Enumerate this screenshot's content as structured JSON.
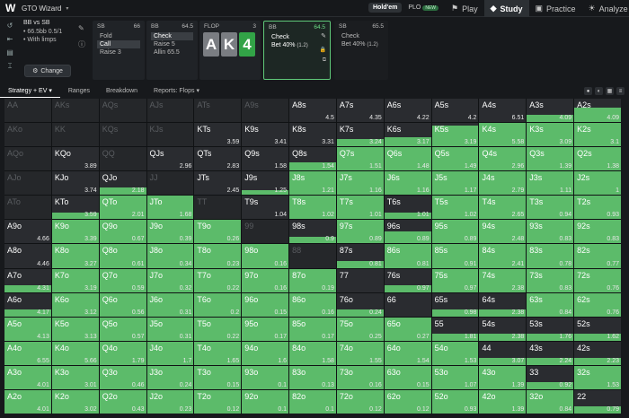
{
  "app": {
    "title": "GTO Wizard"
  },
  "mode": {
    "holdem": "Hold'em",
    "plo": "PLO",
    "plo_badge": "NEW"
  },
  "nav": {
    "play": "Play",
    "study": "Study",
    "practice": "Practice",
    "analyze": "Analyze"
  },
  "scenario": {
    "title": "BB vs SB",
    "stack": "• 66.5bb 0.5/1",
    "limps": "• With limps",
    "change": "Change"
  },
  "nodes": {
    "sb": {
      "pos": "SB",
      "stack": "66",
      "actions": [
        "Fold",
        "Call",
        "Raise 3"
      ]
    },
    "bb": {
      "pos": "BB",
      "stack": "64.5",
      "actions": [
        "Check",
        "Raise 5",
        "Allin 65.5"
      ]
    },
    "flop": {
      "label": "FLOP",
      "pot": "3",
      "cards": [
        "A",
        "K",
        "4"
      ]
    },
    "bb2": {
      "pos": "BB",
      "stack": "64.5",
      "action": "Check",
      "bet": "Bet 40%",
      "bet_size": "(1.2)"
    },
    "sb2": {
      "pos": "SB",
      "stack": "65.5",
      "action": "Check",
      "bet": "Bet 40%",
      "bet_size": "(1.2)"
    }
  },
  "tabs": {
    "strategy": "Strategy + EV",
    "ranges": "Ranges",
    "breakdown": "Breakdown",
    "reports": "Reports: Flops"
  },
  "colors": {
    "bet": "#5cbb6a",
    "check": "#2a2c30",
    "accent": "#6ddf87"
  },
  "matrix": [
    [
      [
        "AA",
        "",
        0,
        1
      ],
      [
        "AKs",
        "",
        0,
        1
      ],
      [
        "AQs",
        "",
        0,
        1
      ],
      [
        "AJs",
        "",
        0,
        1
      ],
      [
        "ATs",
        "",
        0,
        1
      ],
      [
        "A9s",
        "",
        0,
        1
      ],
      [
        "A8s",
        "4.5",
        0,
        0
      ],
      [
        "A7s",
        "4.35",
        0,
        0
      ],
      [
        "A6s",
        "4.22",
        0,
        0
      ],
      [
        "A5s",
        "4.2",
        0,
        0
      ],
      [
        "A4s",
        "6.51",
        0,
        0
      ],
      [
        "A3s",
        "4.09",
        0.3,
        0
      ],
      [
        "A2s",
        "4.09",
        0.6,
        0
      ]
    ],
    [
      [
        "AKo",
        "",
        0,
        1
      ],
      [
        "KK",
        "",
        0,
        1
      ],
      [
        "KQs",
        "",
        0,
        1
      ],
      [
        "KJs",
        "",
        0,
        1
      ],
      [
        "KTs",
        "3.59",
        0,
        0
      ],
      [
        "K9s",
        "3.41",
        0,
        0
      ],
      [
        "K8s",
        "3.31",
        0,
        0
      ],
      [
        "K7s",
        "3.24",
        0.3,
        0
      ],
      [
        "K6s",
        "3.17",
        0.4,
        0
      ],
      [
        "K5s",
        "3.19",
        0.9,
        0
      ],
      [
        "K4s",
        "5.58",
        1,
        0
      ],
      [
        "K3s",
        "3.09",
        1,
        0
      ],
      [
        "K2s",
        "3.1",
        1,
        0
      ]
    ],
    [
      [
        "AQo",
        "",
        0,
        1
      ],
      [
        "KQo",
        "3.89",
        0,
        0
      ],
      [
        "QQ",
        "",
        0,
        1
      ],
      [
        "QJs",
        "2.96",
        0,
        0
      ],
      [
        "QTs",
        "2.83",
        0,
        0
      ],
      [
        "Q9s",
        "1.58",
        0,
        0
      ],
      [
        "Q8s",
        "1.54",
        0.35,
        0
      ],
      [
        "Q7s",
        "1.51",
        1,
        0
      ],
      [
        "Q6s",
        "1.48",
        1,
        0
      ],
      [
        "Q5s",
        "1.49",
        1,
        0
      ],
      [
        "Q4s",
        "2.96",
        1,
        0
      ],
      [
        "Q3s",
        "1.39",
        1,
        0
      ],
      [
        "Q2s",
        "1.38",
        1,
        0
      ]
    ],
    [
      [
        "AJo",
        "",
        0,
        1
      ],
      [
        "KJo",
        "3.74",
        0,
        0
      ],
      [
        "QJo",
        "2.18",
        0.3,
        0
      ],
      [
        "JJ",
        "",
        0,
        1
      ],
      [
        "JTs",
        "2.45",
        0,
        0
      ],
      [
        "J9s",
        "1.25",
        0.2,
        0
      ],
      [
        "J8s",
        "1.21",
        1,
        0
      ],
      [
        "J7s",
        "1.16",
        1,
        0
      ],
      [
        "J6s",
        "1.16",
        1,
        0
      ],
      [
        "J5s",
        "1.17",
        1,
        0
      ],
      [
        "J4s",
        "2.79",
        1,
        0
      ],
      [
        "J3s",
        "1.11",
        1,
        0
      ],
      [
        "J2s",
        "1",
        1,
        0
      ]
    ],
    [
      [
        "ATo",
        "",
        0,
        1
      ],
      [
        "KTo",
        "3.59",
        0.3,
        0
      ],
      [
        "QTo",
        "2.01",
        1,
        0
      ],
      [
        "JTo",
        "1.68",
        1,
        0
      ],
      [
        "TT",
        "",
        0,
        1
      ],
      [
        "T9s",
        "1.04",
        0,
        0
      ],
      [
        "T8s",
        "1.02",
        1,
        0
      ],
      [
        "T7s",
        "1.01",
        1,
        0
      ],
      [
        "T6s",
        "1.01",
        0.3,
        0
      ],
      [
        "T5s",
        "1.02",
        1,
        0
      ],
      [
        "T4s",
        "2.65",
        1,
        0
      ],
      [
        "T3s",
        "0.94",
        1,
        0
      ],
      [
        "T2s",
        "0.93",
        1,
        0
      ]
    ],
    [
      [
        "A9o",
        "4.66",
        0,
        0
      ],
      [
        "K9o",
        "3.39",
        1,
        0
      ],
      [
        "Q9o",
        "0.67",
        1,
        0
      ],
      [
        "J9o",
        "0.39",
        1,
        0
      ],
      [
        "T9o",
        "0.26",
        1,
        0
      ],
      [
        "99",
        "",
        0,
        1
      ],
      [
        "98s",
        "0.9",
        0.3,
        0
      ],
      [
        "97s",
        "0.89",
        1,
        0
      ],
      [
        "96s",
        "0.89",
        0.5,
        0
      ],
      [
        "95s",
        "0.89",
        1,
        0
      ],
      [
        "94s",
        "2.48",
        1,
        0
      ],
      [
        "93s",
        "0.83",
        1,
        0
      ],
      [
        "92s",
        "0.83",
        1,
        0
      ]
    ],
    [
      [
        "A8o",
        "4.46",
        0,
        0
      ],
      [
        "K8o",
        "3.27",
        1,
        0
      ],
      [
        "Q8o",
        "0.61",
        1,
        0
      ],
      [
        "J8o",
        "0.34",
        1,
        0
      ],
      [
        "T8o",
        "0.23",
        1,
        0
      ],
      [
        "98o",
        "0.16",
        1,
        0
      ],
      [
        "88",
        "",
        0,
        1
      ],
      [
        "87s",
        "0.81",
        0.3,
        0
      ],
      [
        "86s",
        "0.81",
        1,
        0
      ],
      [
        "85s",
        "0.91",
        1,
        0
      ],
      [
        "84s",
        "2.41",
        1,
        0
      ],
      [
        "83s",
        "0.78",
        1,
        0
      ],
      [
        "82s",
        "0.77",
        1,
        0
      ]
    ],
    [
      [
        "A7o",
        "4.31",
        0.3,
        0
      ],
      [
        "K7o",
        "3.19",
        1,
        0
      ],
      [
        "Q7o",
        "0.59",
        1,
        0
      ],
      [
        "J7o",
        "0.32",
        1,
        0
      ],
      [
        "T7o",
        "0.22",
        1,
        0
      ],
      [
        "97o",
        "0.16",
        1,
        0
      ],
      [
        "87o",
        "0.19",
        1,
        0
      ],
      [
        "77",
        "",
        0,
        0
      ],
      [
        "76s",
        "0.97",
        0.3,
        0
      ],
      [
        "75s",
        "0.97",
        1,
        0
      ],
      [
        "74s",
        "2.38",
        1,
        0
      ],
      [
        "73s",
        "0.83",
        1,
        0
      ],
      [
        "72s",
        "0.76",
        1,
        0
      ]
    ],
    [
      [
        "A6o",
        "4.17",
        0.3,
        0
      ],
      [
        "K6o",
        "3.12",
        1,
        0
      ],
      [
        "Q6o",
        "0.56",
        1,
        0
      ],
      [
        "J6o",
        "0.31",
        1,
        0
      ],
      [
        "T6o",
        "0.2",
        1,
        0
      ],
      [
        "96o",
        "0.15",
        1,
        0
      ],
      [
        "86o",
        "0.16",
        1,
        0
      ],
      [
        "76o",
        "0.24",
        0.3,
        0
      ],
      [
        "66",
        "",
        0,
        0
      ],
      [
        "65s",
        "0.98",
        0.3,
        0
      ],
      [
        "64s",
        "2.38",
        0.3,
        0
      ],
      [
        "63s",
        "0.84",
        1,
        0
      ],
      [
        "62s",
        "0.76",
        1,
        0
      ]
    ],
    [
      [
        "A5o",
        "4.13",
        1,
        0
      ],
      [
        "K5o",
        "3.13",
        1,
        0
      ],
      [
        "Q5o",
        "0.57",
        1,
        0
      ],
      [
        "J5o",
        "0.31",
        1,
        0
      ],
      [
        "T5o",
        "0.22",
        1,
        0
      ],
      [
        "95o",
        "0.17",
        1,
        0
      ],
      [
        "85o",
        "0.17",
        1,
        0
      ],
      [
        "75o",
        "0.25",
        1,
        0
      ],
      [
        "65o",
        "0.27",
        1,
        0
      ],
      [
        "55",
        "1.81",
        0.3,
        0
      ],
      [
        "54s",
        "2.38",
        0.3,
        0
      ],
      [
        "53s",
        "1.76",
        0.3,
        0
      ],
      [
        "52s",
        "1.62",
        0.3,
        0
      ]
    ],
    [
      [
        "A4o",
        "6.55",
        1,
        0
      ],
      [
        "K4o",
        "5.66",
        1,
        0
      ],
      [
        "Q4o",
        "1.79",
        1,
        0
      ],
      [
        "J4o",
        "1.7",
        1,
        0
      ],
      [
        "T4o",
        "1.65",
        1,
        0
      ],
      [
        "94o",
        "1.6",
        1,
        0
      ],
      [
        "84o",
        "1.58",
        1,
        0
      ],
      [
        "74o",
        "1.55",
        1,
        0
      ],
      [
        "64o",
        "1.54",
        1,
        0
      ],
      [
        "54o",
        "1.53",
        1,
        0
      ],
      [
        "44",
        "3.07",
        0.3,
        0
      ],
      [
        "43s",
        "2.24",
        0.3,
        0
      ],
      [
        "42s",
        "2.23",
        0.3,
        0
      ]
    ],
    [
      [
        "A3o",
        "4.01",
        1,
        0
      ],
      [
        "K3o",
        "3.01",
        1,
        0
      ],
      [
        "Q3o",
        "0.46",
        1,
        0
      ],
      [
        "J3o",
        "0.24",
        1,
        0
      ],
      [
        "T3o",
        "0.15",
        1,
        0
      ],
      [
        "93o",
        "0.1",
        1,
        0
      ],
      [
        "83o",
        "0.13",
        1,
        0
      ],
      [
        "73o",
        "0.16",
        1,
        0
      ],
      [
        "63o",
        "0.15",
        1,
        0
      ],
      [
        "53o",
        "1.07",
        1,
        0
      ],
      [
        "43o",
        "1.39",
        1,
        0
      ],
      [
        "33",
        "0.92",
        0.3,
        0
      ],
      [
        "32s",
        "1.53",
        1,
        0
      ]
    ],
    [
      [
        "A2o",
        "4.01",
        1,
        0
      ],
      [
        "K2o",
        "3.02",
        1,
        0
      ],
      [
        "Q2o",
        "0.43",
        1,
        0
      ],
      [
        "J2o",
        "0.23",
        1,
        0
      ],
      [
        "T2o",
        "0.12",
        1,
        0
      ],
      [
        "92o",
        "0.1",
        1,
        0
      ],
      [
        "82o",
        "0.1",
        1,
        0
      ],
      [
        "72o",
        "0.12",
        1,
        0
      ],
      [
        "62o",
        "0.12",
        1,
        0
      ],
      [
        "52o",
        "0.93",
        1,
        0
      ],
      [
        "42o",
        "1.39",
        1,
        0
      ],
      [
        "32o",
        "0.84",
        1,
        0
      ],
      [
        "22",
        "0.79",
        0.3,
        0
      ]
    ]
  ]
}
